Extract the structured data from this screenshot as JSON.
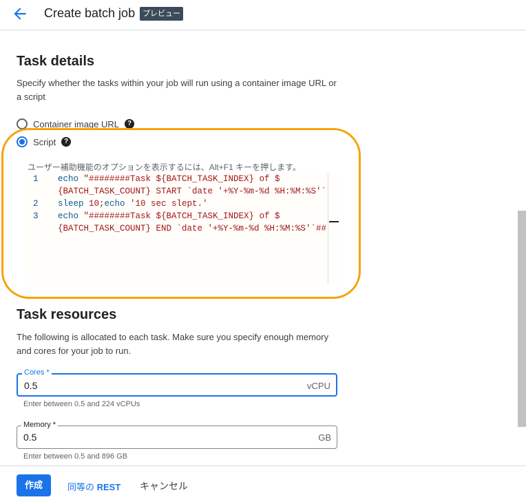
{
  "header": {
    "title": "Create batch job",
    "badge": "プレビュー"
  },
  "task_details": {
    "heading": "Task details",
    "description": "Specify whether the tasks within your job will run using a container image URL or a script",
    "options": [
      {
        "label": "Container image URL",
        "selected": false
      },
      {
        "label": "Script",
        "selected": true
      }
    ]
  },
  "editor": {
    "hint": "ユーザー補助機能のオプションを表示するには、Alt+F1 キーを押します。",
    "lines": [
      {
        "num": "1",
        "rows": [
          "echo \"########Task ${BATCH_TASK_INDEX} of $",
          "{BATCH_TASK_COUNT} START `date '+%Y-%m-%d %H:%M:%S'`"
        ]
      },
      {
        "num": "2",
        "rows": [
          "sleep 10;echo '10 sec slept.'"
        ]
      },
      {
        "num": "3",
        "rows": [
          "echo \"########Task ${BATCH_TASK_INDEX} of $",
          "{BATCH_TASK_COUNT} END `date '+%Y-%m-%d %H:%M:%S'`##"
        ]
      }
    ]
  },
  "task_resources": {
    "heading": "Task resources",
    "description": "The following is allocated to each task. Make sure you specify enough memory and cores for your job to run.",
    "cores": {
      "label": "Cores *",
      "value": "0.5",
      "unit": "vCPU",
      "hint": "Enter between 0.5 and 224 vCPUs"
    },
    "memory": {
      "label": "Memory *",
      "value": "0.5",
      "unit": "GB",
      "hint": "Enter between 0.5 and 896 GB"
    }
  },
  "footer": {
    "create": "作成",
    "rest_prefix": "同等の ",
    "rest_strong": "REST",
    "cancel": "キャンセル"
  },
  "colors": {
    "accent": "#1a73e8",
    "highlight": "#f6a20a"
  }
}
